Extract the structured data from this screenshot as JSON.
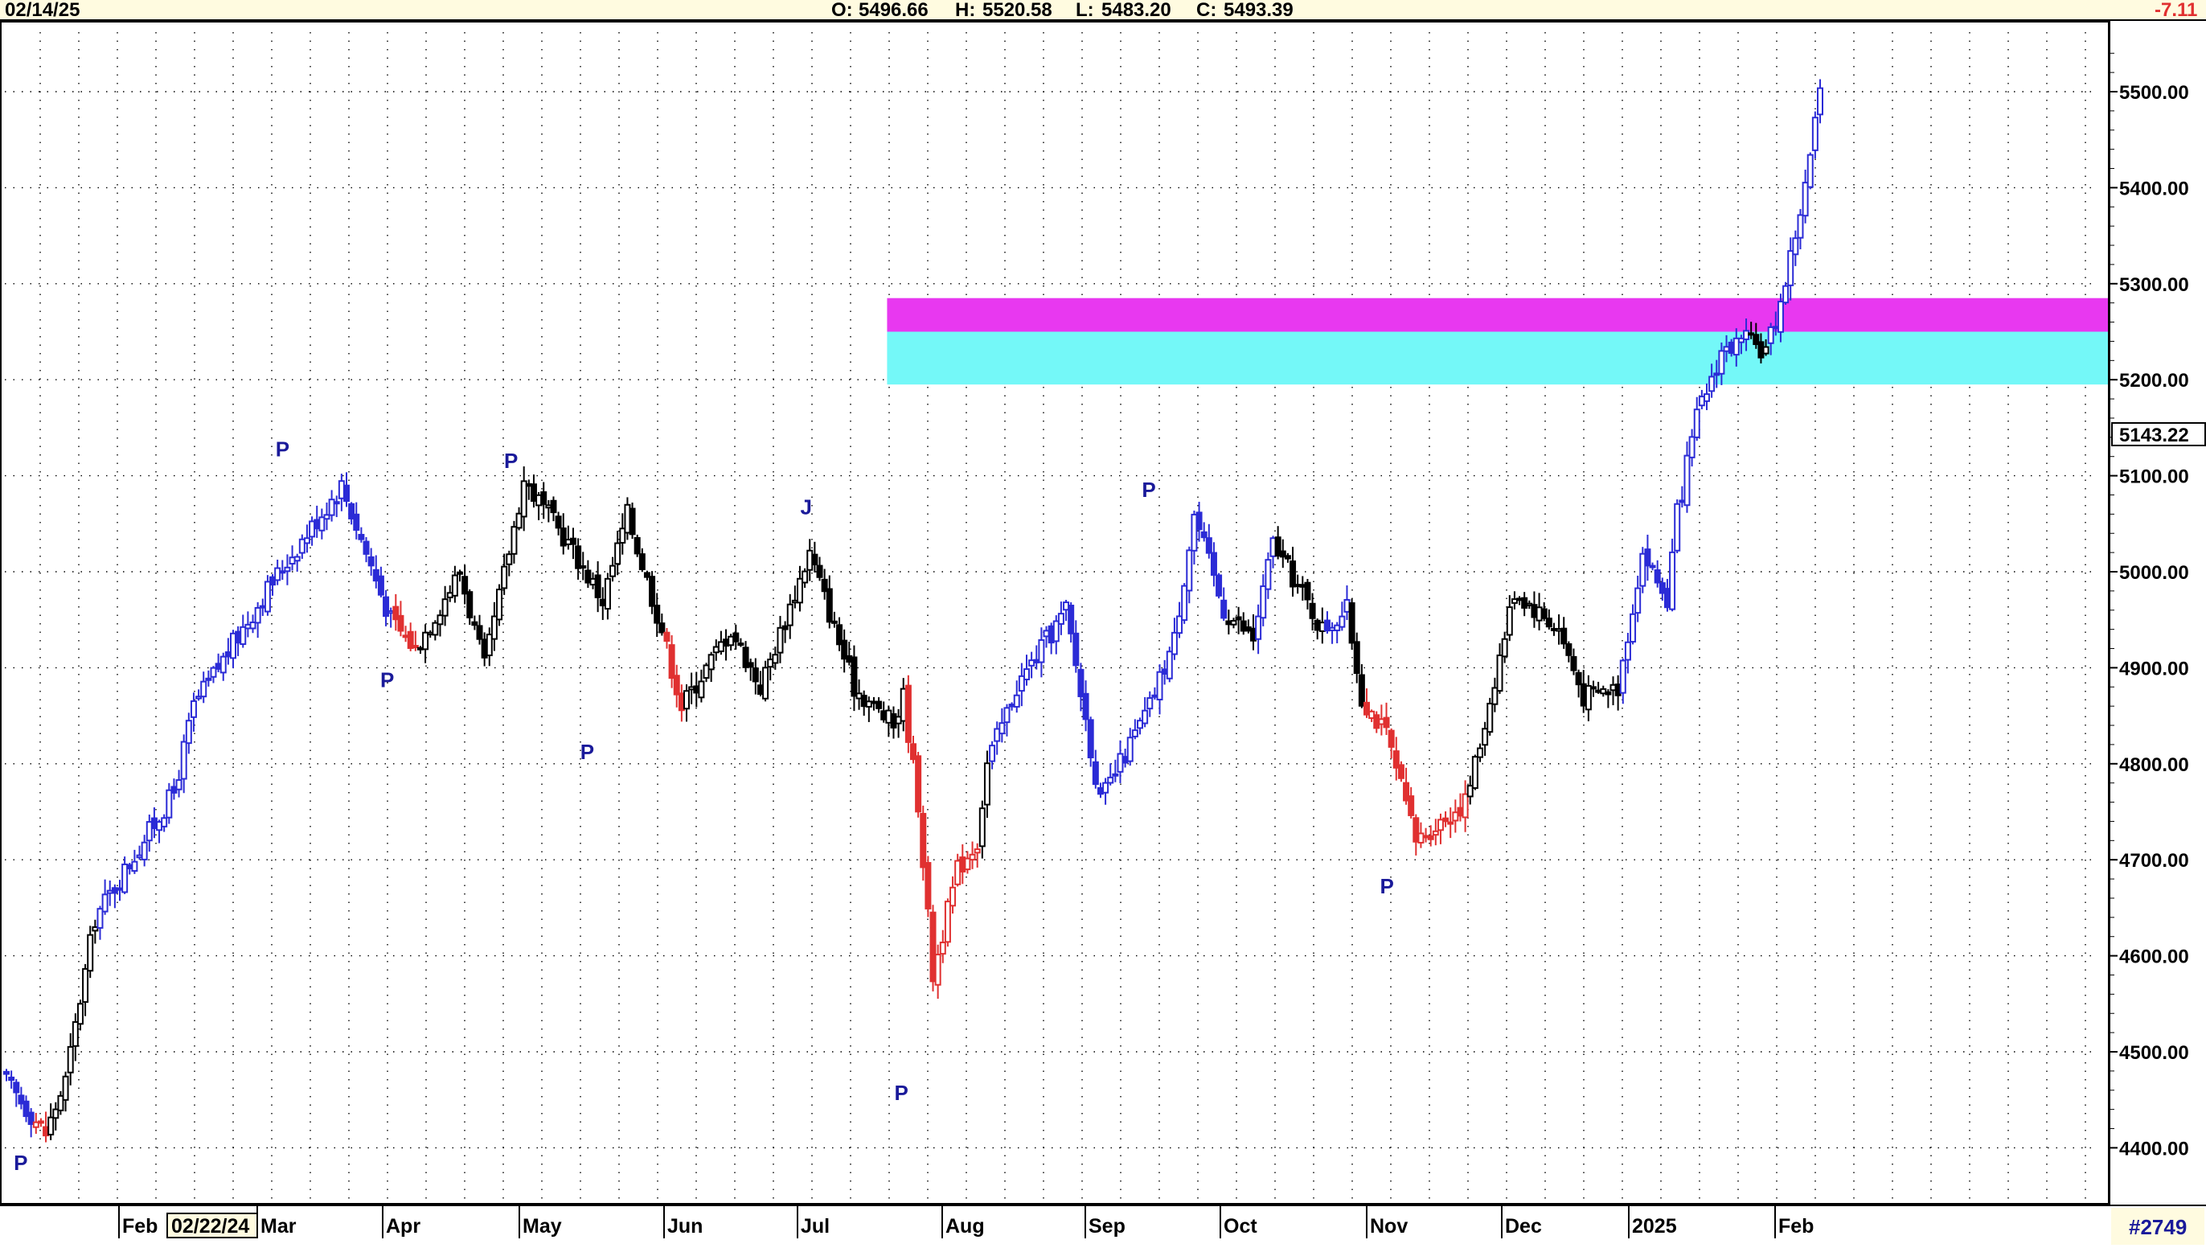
{
  "header": {
    "date": "02/14/25",
    "open_label": "O:",
    "open": "5496.66",
    "high_label": "H:",
    "high": "5520.58",
    "low_label": "L:",
    "low": "5483.20",
    "close_label": "C:",
    "close": "5493.39",
    "change": "-7.11"
  },
  "footer": {
    "symbol_id": "#2749",
    "cursor_date": "02/22/24",
    "months": [
      "Feb",
      "Mar",
      "Apr",
      "May",
      "Jun",
      "Jul",
      "Aug",
      "Sep",
      "Oct",
      "Nov",
      "Dec",
      "2025",
      "Feb"
    ]
  },
  "price_tag": "5143.22",
  "chart_data": {
    "type": "candlestick",
    "x_range": [
      "2024-01-30",
      "2025-02-14"
    ],
    "ylim": [
      4375,
      5560
    ],
    "y_ticks": [
      "5500.00",
      "5400.00",
      "5300.00",
      "5200.00",
      "5100.00",
      "5000.00",
      "4900.00",
      "4800.00",
      "4700.00",
      "4600.00",
      "4500.00",
      "4400.00"
    ],
    "grid": true,
    "colors": {
      "up": "#2b2bd6",
      "neutral": "#000000",
      "down": "#e03030",
      "zone_upper": "#e838f0",
      "zone_lower": "#74f8f8",
      "marker": "#1a1a9a"
    },
    "zones": [
      {
        "name": "upper",
        "from_date": "2024-08-02",
        "y_low": 5250,
        "y_high": 5285
      },
      {
        "name": "lower",
        "from_date": "2024-08-02",
        "y_low": 5195,
        "y_high": 5250
      }
    ],
    "segments": [
      {
        "from": 4475,
        "to": 4435,
        "n": 6,
        "color": "blue"
      },
      {
        "from": 4435,
        "to": 4415,
        "n": 3,
        "color": "red"
      },
      {
        "from": 4415,
        "to": 4470,
        "n": 4,
        "color": "black"
      },
      {
        "from": 4470,
        "to": 4640,
        "n": 6,
        "color": "black"
      },
      {
        "from": 4640,
        "to": 4770,
        "n": 16,
        "color": "blue"
      },
      {
        "from": 4770,
        "to": 4860,
        "n": 4,
        "color": "blue"
      },
      {
        "from": 4860,
        "to": 4990,
        "n": 16,
        "color": "blue"
      },
      {
        "from": 4990,
        "to": 5090,
        "n": 14,
        "color": "blue"
      },
      {
        "from": 5090,
        "to": 4950,
        "n": 10,
        "color": "blue"
      },
      {
        "from": 4950,
        "to": 4920,
        "n": 5,
        "color": "red"
      },
      {
        "from": 4920,
        "to": 5000,
        "n": 9,
        "color": "black"
      },
      {
        "from": 5000,
        "to": 4900,
        "n": 5,
        "color": "black"
      },
      {
        "from": 4900,
        "to": 5095,
        "n": 8,
        "color": "black"
      },
      {
        "from": 5095,
        "to": 5030,
        "n": 9,
        "color": "black"
      },
      {
        "from": 5030,
        "to": 4970,
        "n": 7,
        "color": "black"
      },
      {
        "from": 4970,
        "to": 5060,
        "n": 5,
        "color": "black"
      },
      {
        "from": 5060,
        "to": 4940,
        "n": 7,
        "color": "black"
      },
      {
        "from": 4940,
        "to": 4860,
        "n": 4,
        "color": "red"
      },
      {
        "from": 4860,
        "to": 4940,
        "n": 10,
        "color": "black"
      },
      {
        "from": 4940,
        "to": 4880,
        "n": 6,
        "color": "black"
      },
      {
        "from": 4880,
        "to": 5020,
        "n": 10,
        "color": "black"
      },
      {
        "from": 5020,
        "to": 4880,
        "n": 9,
        "color": "black"
      },
      {
        "from": 4880,
        "to": 4840,
        "n": 8,
        "color": "black"
      },
      {
        "from": 4840,
        "to": 4870,
        "n": 2,
        "color": "black"
      },
      {
        "from": 4870,
        "to": 4760,
        "n": 3,
        "color": "red"
      },
      {
        "from": 4760,
        "to": 4580,
        "n": 3,
        "color": "red"
      },
      {
        "from": 4580,
        "to": 4690,
        "n": 5,
        "color": "red"
      },
      {
        "from": 4690,
        "to": 4720,
        "n": 4,
        "color": "red"
      },
      {
        "from": 4720,
        "to": 4800,
        "n": 2,
        "color": "black"
      },
      {
        "from": 4800,
        "to": 4880,
        "n": 6,
        "color": "blue"
      },
      {
        "from": 4880,
        "to": 4960,
        "n": 10,
        "color": "blue"
      },
      {
        "from": 4960,
        "to": 4760,
        "n": 7,
        "color": "blue"
      },
      {
        "from": 4760,
        "to": 4860,
        "n": 10,
        "color": "blue"
      },
      {
        "from": 4860,
        "to": 4930,
        "n": 5,
        "color": "blue"
      },
      {
        "from": 4930,
        "to": 5060,
        "n": 4,
        "color": "blue"
      },
      {
        "from": 5060,
        "to": 4960,
        "n": 6,
        "color": "blue"
      },
      {
        "from": 4960,
        "to": 4930,
        "n": 6,
        "color": "black"
      },
      {
        "from": 4930,
        "to": 5030,
        "n": 4,
        "color": "blue"
      },
      {
        "from": 5030,
        "to": 4940,
        "n": 10,
        "color": "black"
      },
      {
        "from": 4940,
        "to": 4960,
        "n": 5,
        "color": "blue"
      },
      {
        "from": 4960,
        "to": 4870,
        "n": 3,
        "color": "black"
      },
      {
        "from": 4870,
        "to": 4830,
        "n": 5,
        "color": "red"
      },
      {
        "from": 4830,
        "to": 4720,
        "n": 6,
        "color": "red"
      },
      {
        "from": 4720,
        "to": 4760,
        "n": 10,
        "color": "red"
      },
      {
        "from": 4760,
        "to": 4820,
        "n": 3,
        "color": "black"
      },
      {
        "from": 4820,
        "to": 4980,
        "n": 7,
        "color": "black"
      },
      {
        "from": 4980,
        "to": 4940,
        "n": 9,
        "color": "black"
      },
      {
        "from": 4940,
        "to": 4870,
        "n": 5,
        "color": "black"
      },
      {
        "from": 4870,
        "to": 4880,
        "n": 7,
        "color": "black"
      },
      {
        "from": 4880,
        "to": 5020,
        "n": 5,
        "color": "blue"
      },
      {
        "from": 5020,
        "to": 4970,
        "n": 5,
        "color": "blue"
      },
      {
        "from": 4970,
        "to": 5060,
        "n": 2,
        "color": "blue"
      },
      {
        "from": 5060,
        "to": 5160,
        "n": 4,
        "color": "blue"
      },
      {
        "from": 5160,
        "to": 5230,
        "n": 5,
        "color": "blue"
      },
      {
        "from": 5230,
        "to": 5240,
        "n": 5,
        "color": "blue"
      },
      {
        "from": 5240,
        "to": 5230,
        "n": 4,
        "color": "black"
      },
      {
        "from": 5230,
        "to": 5280,
        "n": 3,
        "color": "blue"
      },
      {
        "from": 5280,
        "to": 5400,
        "n": 5,
        "color": "blue"
      },
      {
        "from": 5400,
        "to": 5500,
        "n": 3,
        "color": "blue"
      }
    ],
    "markers": [
      {
        "label": "P",
        "date": "2024-02-02",
        "value": 4402,
        "position": "below"
      },
      {
        "label": "P",
        "date": "2024-03-28",
        "value": 5110,
        "position": "above"
      },
      {
        "label": "P",
        "date": "2024-04-19",
        "value": 4905,
        "position": "below"
      },
      {
        "label": "P",
        "date": "2024-05-15",
        "value": 5098,
        "position": "above"
      },
      {
        "label": "P",
        "date": "2024-05-31",
        "value": 4830,
        "position": "below"
      },
      {
        "label": "J",
        "date": "2024-07-16",
        "value": 5050,
        "position": "above"
      },
      {
        "label": "P",
        "date": "2024-08-05",
        "value": 4475,
        "position": "below"
      },
      {
        "label": "P",
        "date": "2024-09-26",
        "value": 5068,
        "position": "above"
      },
      {
        "label": "P",
        "date": "2024-11-15",
        "value": 4690,
        "position": "below"
      }
    ]
  }
}
